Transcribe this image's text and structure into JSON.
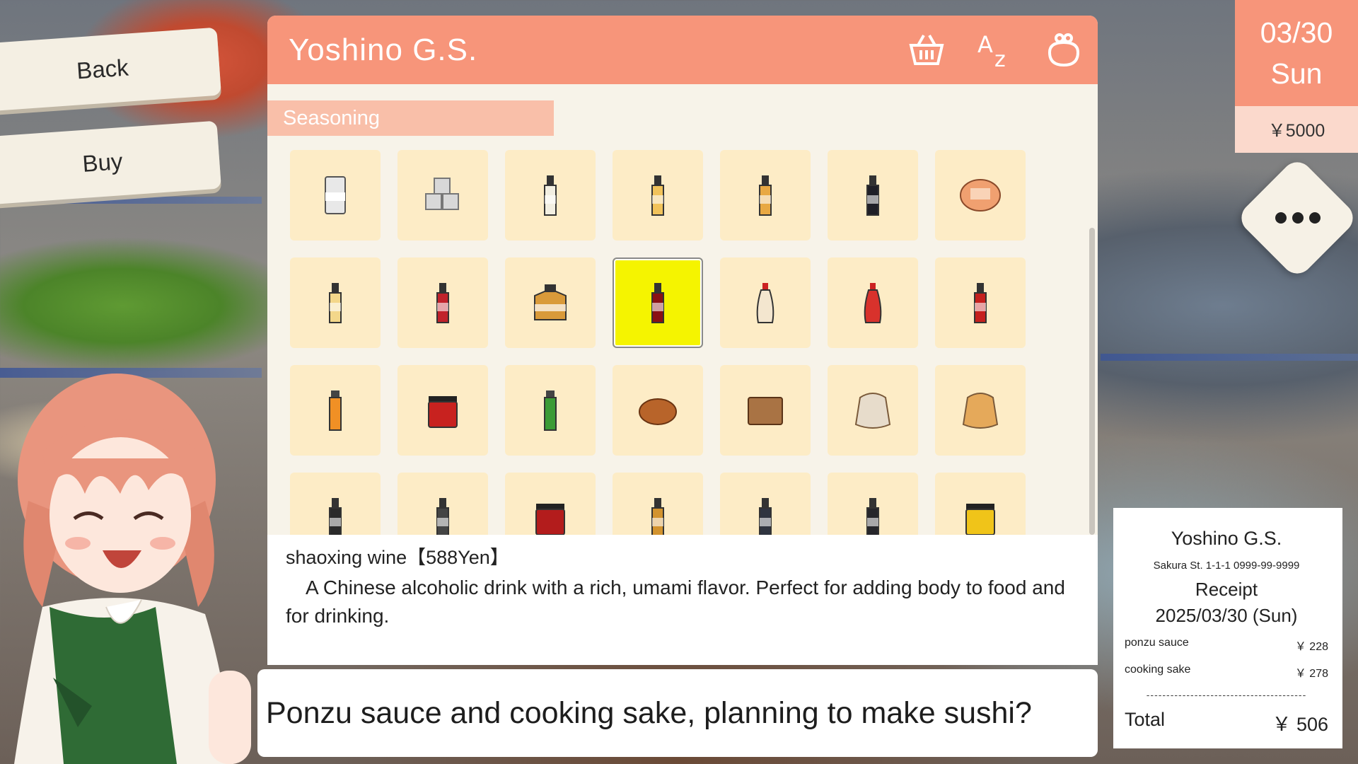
{
  "store": {
    "name": "Yoshino G.S."
  },
  "nav": {
    "back_label": "Back",
    "buy_label": "Buy"
  },
  "header_icons": [
    "basket-icon",
    "sort-az-icon",
    "coin-purse-icon"
  ],
  "category": {
    "label": "Seasoning"
  },
  "items": [
    {
      "name": "item-salt-canister",
      "shape": "can",
      "color": "#e8e8e8"
    },
    {
      "name": "item-sugar-cubes",
      "shape": "cubes",
      "color": "#d8d8d8"
    },
    {
      "name": "item-vinegar-bottle",
      "shape": "bottle",
      "color": "#f2efe2"
    },
    {
      "name": "item-mirin-bottle",
      "shape": "bottle",
      "color": "#f1c35b"
    },
    {
      "name": "item-cooking-oil-bottle",
      "shape": "bottle",
      "color": "#e8a843"
    },
    {
      "name": "item-soy-sauce-bottle",
      "shape": "bottle",
      "color": "#1f1f27"
    },
    {
      "name": "item-miso-pack",
      "shape": "pack",
      "color": "#f0a070"
    },
    {
      "name": "item-sesame-oil-bottle",
      "shape": "bottle",
      "color": "#f3d78a"
    },
    {
      "name": "item-ponzu-bottle",
      "shape": "bottle",
      "color": "#c0222b"
    },
    {
      "name": "item-honey-jar",
      "shape": "jar",
      "color": "#d99a3a"
    },
    {
      "name": "item-shaoxing-wine-bottle",
      "shape": "bottle",
      "color": "#8a1014",
      "selected": true
    },
    {
      "name": "item-mayonnaise-bottle",
      "shape": "squeeze",
      "color": "#f3e6cf"
    },
    {
      "name": "item-ketchup-bottle",
      "shape": "squeeze",
      "color": "#d8322c"
    },
    {
      "name": "item-chili-sauce-bottle",
      "shape": "bottle",
      "color": "#c5201e"
    },
    {
      "name": "item-karashi-tube",
      "shape": "tube",
      "color": "#f09025"
    },
    {
      "name": "item-gochujang-tub",
      "shape": "tub",
      "color": "#c8221f"
    },
    {
      "name": "item-wasabi-tube",
      "shape": "tube",
      "color": "#3c9b36"
    },
    {
      "name": "item-curry-roux",
      "shape": "blob",
      "color": "#b8642a"
    },
    {
      "name": "item-brown-sugar-block",
      "shape": "block",
      "color": "#a97344"
    },
    {
      "name": "item-bread-crumbs-bag",
      "shape": "bag",
      "color": "#e7dccb"
    },
    {
      "name": "item-tempura-flour-bag",
      "shape": "bag",
      "color": "#e5a95a"
    },
    {
      "name": "item-sauce-bottle-a",
      "shape": "bottle",
      "color": "#2a2a2a"
    },
    {
      "name": "item-sauce-bottle-b",
      "shape": "bottle",
      "color": "#444444"
    },
    {
      "name": "item-jam-jar",
      "shape": "tub",
      "color": "#b31c1c"
    },
    {
      "name": "item-dressing-bottle",
      "shape": "bottle",
      "color": "#d2932e"
    },
    {
      "name": "item-dark-sauce-bottle",
      "shape": "bottle",
      "color": "#2f3440"
    },
    {
      "name": "item-fish-sauce-bottle",
      "shape": "bottle",
      "color": "#26262b"
    },
    {
      "name": "item-mustard-jar",
      "shape": "tub",
      "color": "#f0c419"
    }
  ],
  "description": {
    "title": "shaoxing wine【588Yen】",
    "text": "A Chinese alcoholic drink with a rich, umami flavor. Perfect for adding body to food and for drinking."
  },
  "dialogue": {
    "text": "Ponzu sauce and cooking sake, planning to make sushi?"
  },
  "date": {
    "day": "03/30",
    "weekday": "Sun",
    "money": "￥5000"
  },
  "receipt": {
    "store": "Yoshino G.S.",
    "address": "Sakura St. 1-1-1 0999-99-9999",
    "title": "Receipt",
    "date": "2025/03/30 (Sun)",
    "items": [
      {
        "name": "ponzu sauce",
        "price": "￥ 228"
      },
      {
        "name": "cooking sake",
        "price": "￥ 278"
      }
    ],
    "separator": "----------------------------------------",
    "total_label": "Total",
    "total_value": "￥ 506"
  },
  "colors": {
    "accent": "#f7957a",
    "accent_light": "#f9bfa9",
    "cell": "#fdecc6",
    "selected": "#f5f400"
  }
}
